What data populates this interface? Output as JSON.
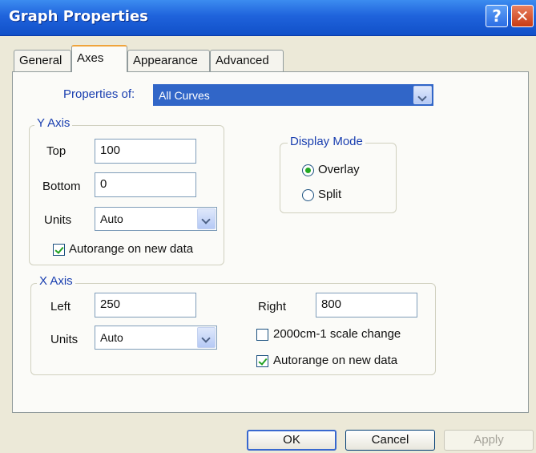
{
  "window": {
    "title": "Graph Properties"
  },
  "tabs": [
    {
      "label": "General",
      "selected": false
    },
    {
      "label": "Axes",
      "selected": true
    },
    {
      "label": "Appearance",
      "selected": false
    },
    {
      "label": "Advanced",
      "selected": false
    }
  ],
  "properties_of": {
    "label": "Properties of:",
    "value": "All Curves"
  },
  "y_axis": {
    "title": "Y Axis",
    "top_label": "Top",
    "top_value": "100",
    "bottom_label": "Bottom",
    "bottom_value": "0",
    "units_label": "Units",
    "units_value": "Auto",
    "autorange_label": "Autorange on new data",
    "autorange_checked": true
  },
  "display_mode": {
    "title": "Display Mode",
    "overlay_label": "Overlay",
    "split_label": "Split",
    "selected": "Overlay"
  },
  "x_axis": {
    "title": "X Axis",
    "left_label": "Left",
    "left_value": "250",
    "right_label": "Right",
    "right_value": "800",
    "units_label": "Units",
    "units_value": "Auto",
    "scale_change_label": "2000cm-1 scale change",
    "scale_change_checked": false,
    "autorange_label": "Autorange on new data",
    "autorange_checked": true
  },
  "buttons": {
    "ok": "OK",
    "cancel": "Cancel",
    "apply": "Apply"
  },
  "colors": {
    "titlebar": "#1f63dc",
    "accent_text": "#1a3fb0",
    "dialog_bg": "#ece9d8"
  }
}
